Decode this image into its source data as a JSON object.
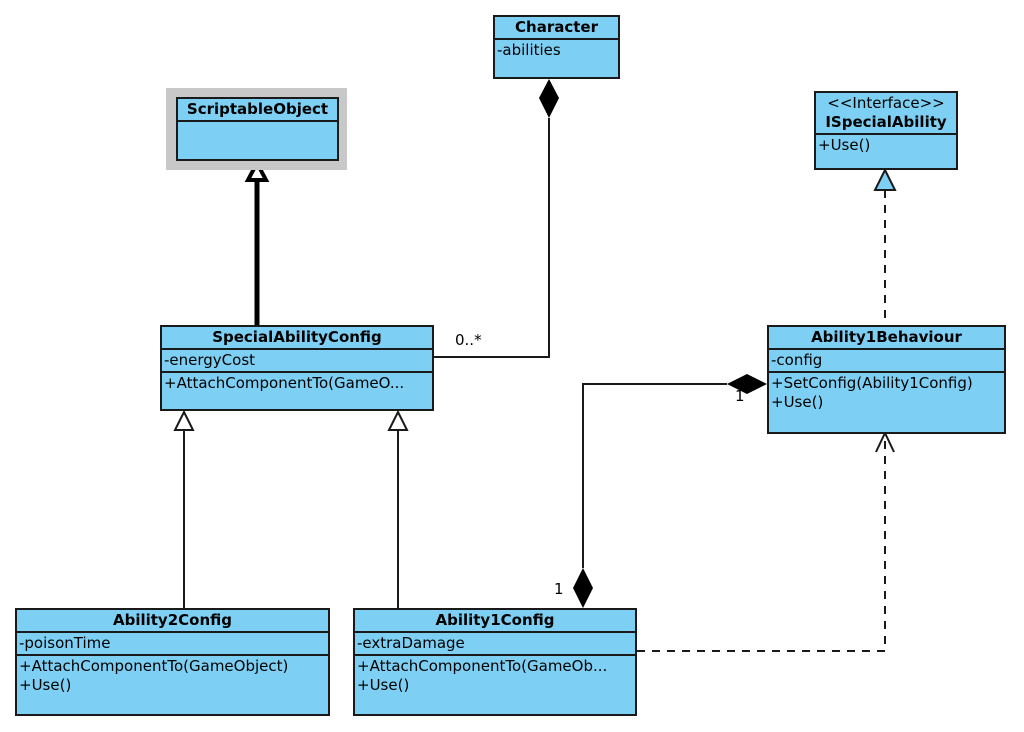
{
  "diagram": {
    "type": "UML class diagram",
    "fill_color": "#7dd0f4",
    "shadow_color": "#c8c8c8"
  },
  "classes": {
    "character": {
      "name": "Character",
      "attributes": [
        "-abilities"
      ],
      "operations": []
    },
    "scriptable_object": {
      "name": "ScriptableObject",
      "attributes": [],
      "operations": []
    },
    "ispecial_ability": {
      "stereotype": "<<Interface>>",
      "name": "ISpecialAbility",
      "operations": [
        "+Use()"
      ]
    },
    "special_ability_config": {
      "name": "SpecialAbilityConfig",
      "attributes": [
        "-energyCost"
      ],
      "operations": [
        "+AttachComponentTo(GameO..."
      ]
    },
    "ability1_behaviour": {
      "name": "Ability1Behaviour",
      "attributes": [
        "-config"
      ],
      "operations": [
        "+SetConfig(Ability1Config)",
        "+Use()"
      ]
    },
    "ability2_config": {
      "name": "Ability2Config",
      "attributes": [
        "-poisonTime"
      ],
      "operations": [
        "+AttachComponentTo(GameObject)",
        "+Use()"
      ]
    },
    "ability1_config": {
      "name": "Ability1Config",
      "attributes": [
        "-extraDamage"
      ],
      "operations": [
        "+AttachComponentTo(GameOb...",
        "+Use()"
      ]
    }
  },
  "relationships": [
    {
      "kind": "composition",
      "whole": "Character",
      "part": "SpecialAbilityConfig",
      "part_multiplicity": "0..*"
    },
    {
      "kind": "generalization",
      "child": "SpecialAbilityConfig",
      "parent": "ScriptableObject"
    },
    {
      "kind": "generalization",
      "child": "Ability2Config",
      "parent": "SpecialAbilityConfig"
    },
    {
      "kind": "generalization",
      "child": "Ability1Config",
      "parent": "SpecialAbilityConfig"
    },
    {
      "kind": "realization",
      "implementer": "Ability1Behaviour",
      "interface": "ISpecialAbility"
    },
    {
      "kind": "composition",
      "end_a": "Ability1Behaviour",
      "end_a_multiplicity": "1",
      "end_b": "Ability1Config",
      "end_b_multiplicity": "1"
    },
    {
      "kind": "dependency",
      "from": "Ability1Config",
      "to": "Ability1Behaviour"
    }
  ],
  "labels": {
    "char_to_config_mult": "0..*",
    "behaviour_end_mult": "1",
    "config_end_mult": "1"
  }
}
